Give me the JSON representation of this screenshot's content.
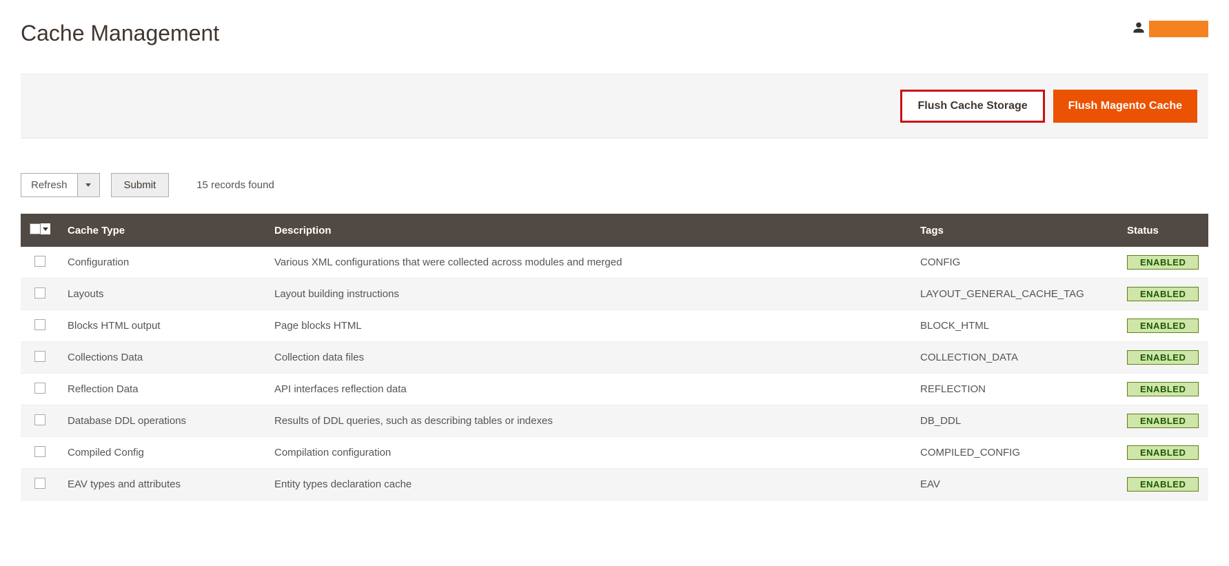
{
  "header": {
    "title": "Cache Management"
  },
  "actions": {
    "flush_storage_label": "Flush Cache Storage",
    "flush_magento_label": "Flush Magento Cache"
  },
  "controls": {
    "select_label": "Refresh",
    "submit_label": "Submit",
    "records_text": "15 records found"
  },
  "table": {
    "headers": {
      "type": "Cache Type",
      "description": "Description",
      "tags": "Tags",
      "status": "Status"
    },
    "rows": [
      {
        "type": "Configuration",
        "description": "Various XML configurations that were collected across modules and merged",
        "tags": "CONFIG",
        "status": "ENABLED"
      },
      {
        "type": "Layouts",
        "description": "Layout building instructions",
        "tags": "LAYOUT_GENERAL_CACHE_TAG",
        "status": "ENABLED"
      },
      {
        "type": "Blocks HTML output",
        "description": "Page blocks HTML",
        "tags": "BLOCK_HTML",
        "status": "ENABLED"
      },
      {
        "type": "Collections Data",
        "description": "Collection data files",
        "tags": "COLLECTION_DATA",
        "status": "ENABLED"
      },
      {
        "type": "Reflection Data",
        "description": "API interfaces reflection data",
        "tags": "REFLECTION",
        "status": "ENABLED"
      },
      {
        "type": "Database DDL operations",
        "description": "Results of DDL queries, such as describing tables or indexes",
        "tags": "DB_DDL",
        "status": "ENABLED"
      },
      {
        "type": "Compiled Config",
        "description": "Compilation configuration",
        "tags": "COMPILED_CONFIG",
        "status": "ENABLED"
      },
      {
        "type": "EAV types and attributes",
        "description": "Entity types declaration cache",
        "tags": "EAV",
        "status": "ENABLED"
      }
    ]
  }
}
